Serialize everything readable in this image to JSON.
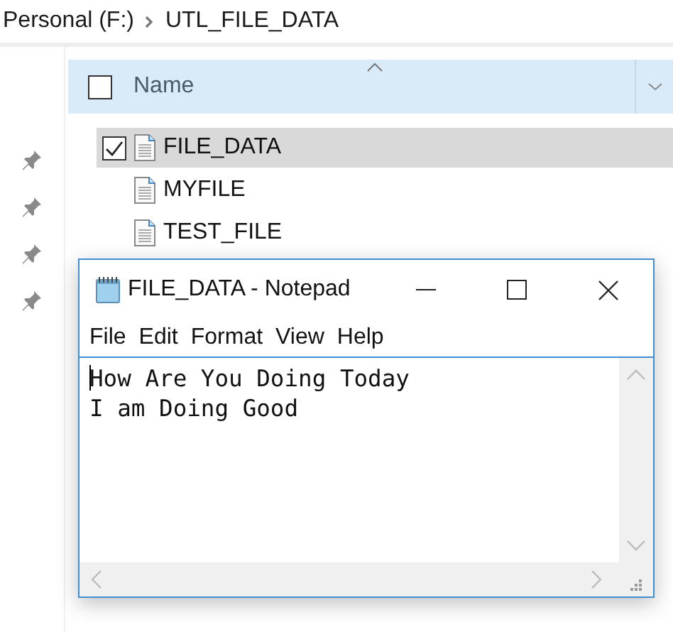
{
  "breadcrumb": [
    {
      "label": "Personal (F:)"
    },
    {
      "label": "UTL_FILE_DATA"
    }
  ],
  "header": {
    "label": "Name",
    "checked": false
  },
  "files": [
    {
      "name": "FILE_DATA",
      "selected": true,
      "checked": true
    },
    {
      "name": "MYFILE",
      "selected": false,
      "checked": false
    },
    {
      "name": "TEST_FILE",
      "selected": false,
      "checked": false
    }
  ],
  "notepad": {
    "title": "FILE_DATA - Notepad",
    "menu": [
      "File",
      "Edit",
      "Format",
      "View",
      "Help"
    ],
    "lines": [
      "How Are You Doing Today",
      "I am Doing Good"
    ]
  }
}
